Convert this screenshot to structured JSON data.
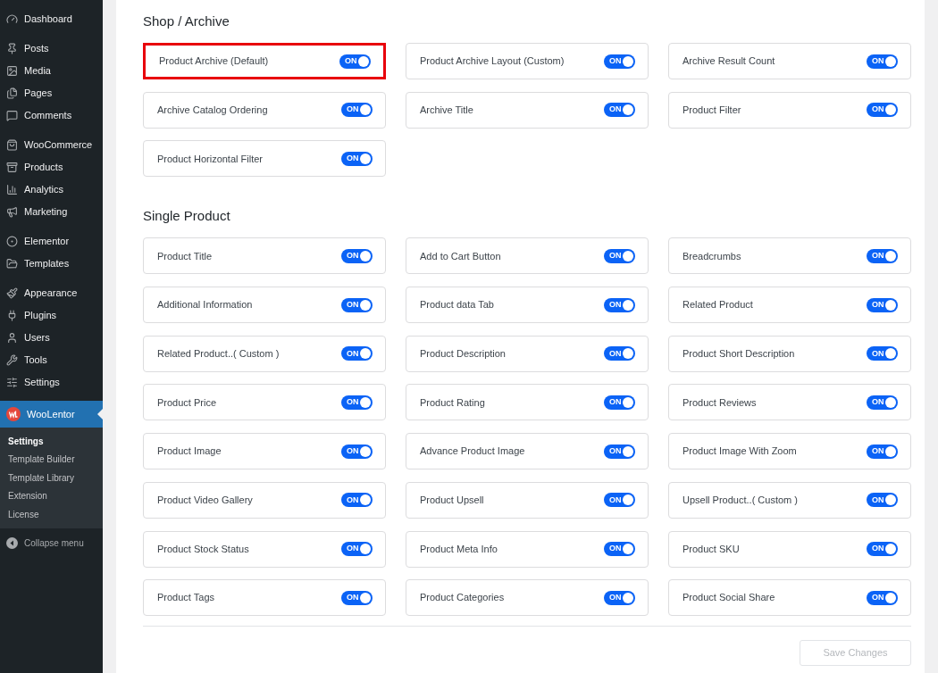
{
  "sidebar": {
    "groups": [
      [
        {
          "label": "Dashboard",
          "selected": false
        }
      ],
      [
        {
          "label": "Posts",
          "selected": false
        },
        {
          "label": "Media",
          "selected": false
        },
        {
          "label": "Pages",
          "selected": false
        },
        {
          "label": "Comments",
          "selected": false
        }
      ],
      [
        {
          "label": "WooCommerce",
          "selected": false
        },
        {
          "label": "Products",
          "selected": false
        },
        {
          "label": "Analytics",
          "selected": false
        },
        {
          "label": "Marketing",
          "selected": false
        }
      ],
      [
        {
          "label": "Elementor",
          "selected": false
        },
        {
          "label": "Templates",
          "selected": false
        }
      ],
      [
        {
          "label": "Appearance",
          "selected": false
        },
        {
          "label": "Plugins",
          "selected": false
        },
        {
          "label": "Users",
          "selected": false
        },
        {
          "label": "Tools",
          "selected": false
        },
        {
          "label": "Settings",
          "selected": false
        }
      ],
      [
        {
          "label": "WooLentor",
          "selected": true,
          "children": [
            {
              "label": "Settings",
              "selected": true
            },
            {
              "label": "Template Builder",
              "selected": false
            },
            {
              "label": "Template Library",
              "selected": false
            },
            {
              "label": "Extension",
              "selected": false
            },
            {
              "label": "License",
              "selected": false
            }
          ]
        }
      ]
    ],
    "collapse": "Collapse menu"
  },
  "sections": [
    {
      "title": "Shop / Archive",
      "items": [
        {
          "label": "Product Archive (Default)",
          "toggle": "ON",
          "on": true,
          "highlighted": true
        },
        {
          "label": "Product Archive Layout (Custom)",
          "toggle": "ON",
          "on": true,
          "highlighted": false
        },
        {
          "label": "Archive Result Count",
          "toggle": "ON",
          "on": true,
          "highlighted": false
        },
        {
          "label": "Archive Catalog Ordering",
          "toggle": "ON",
          "on": true,
          "highlighted": false
        },
        {
          "label": "Archive Title",
          "toggle": "ON",
          "on": true,
          "highlighted": false
        },
        {
          "label": "Product Filter",
          "toggle": "ON",
          "on": true,
          "highlighted": false
        },
        {
          "label": "Product Horizontal Filter",
          "toggle": "ON",
          "on": true,
          "highlighted": false
        }
      ]
    },
    {
      "title": "Single Product",
      "items": [
        {
          "label": "Product Title",
          "toggle": "ON",
          "on": true,
          "highlighted": false
        },
        {
          "label": "Add to Cart Button",
          "toggle": "ON",
          "on": true,
          "highlighted": false
        },
        {
          "label": "Breadcrumbs",
          "toggle": "ON",
          "on": true,
          "highlighted": false
        },
        {
          "label": "Additional Information",
          "toggle": "ON",
          "on": true,
          "highlighted": false
        },
        {
          "label": "Product data Tab",
          "toggle": "ON",
          "on": true,
          "highlighted": false
        },
        {
          "label": "Related Product",
          "toggle": "ON",
          "on": true,
          "highlighted": false
        },
        {
          "label": "Related Product..( Custom )",
          "toggle": "ON",
          "on": true,
          "highlighted": false
        },
        {
          "label": "Product Description",
          "toggle": "ON",
          "on": true,
          "highlighted": false
        },
        {
          "label": "Product Short Description",
          "toggle": "ON",
          "on": true,
          "highlighted": false
        },
        {
          "label": "Product Price",
          "toggle": "ON",
          "on": true,
          "highlighted": false
        },
        {
          "label": "Product Rating",
          "toggle": "ON",
          "on": true,
          "highlighted": false
        },
        {
          "label": "Product Reviews",
          "toggle": "ON",
          "on": true,
          "highlighted": false
        },
        {
          "label": "Product Image",
          "toggle": "ON",
          "on": true,
          "highlighted": false
        },
        {
          "label": "Advance Product Image",
          "toggle": "ON",
          "on": true,
          "highlighted": false
        },
        {
          "label": "Product Image With Zoom",
          "toggle": "ON",
          "on": true,
          "highlighted": false
        },
        {
          "label": "Product Video Gallery",
          "toggle": "ON",
          "on": true,
          "highlighted": false
        },
        {
          "label": "Product Upsell",
          "toggle": "ON",
          "on": true,
          "highlighted": false
        },
        {
          "label": "Upsell Product..( Custom )",
          "toggle": "ON",
          "on": true,
          "highlighted": false
        },
        {
          "label": "Product Stock Status",
          "toggle": "ON",
          "on": true,
          "highlighted": false
        },
        {
          "label": "Product Meta Info",
          "toggle": "ON",
          "on": true,
          "highlighted": false
        },
        {
          "label": "Product SKU",
          "toggle": "ON",
          "on": true,
          "highlighted": false
        },
        {
          "label": "Product Tags",
          "toggle": "ON",
          "on": true,
          "highlighted": false
        },
        {
          "label": "Product Categories",
          "toggle": "ON",
          "on": true,
          "highlighted": false
        },
        {
          "label": "Product Social Share",
          "toggle": "ON",
          "on": true,
          "highlighted": false
        }
      ]
    }
  ],
  "save_button": {
    "label": "Save Changes",
    "disabled": true
  }
}
